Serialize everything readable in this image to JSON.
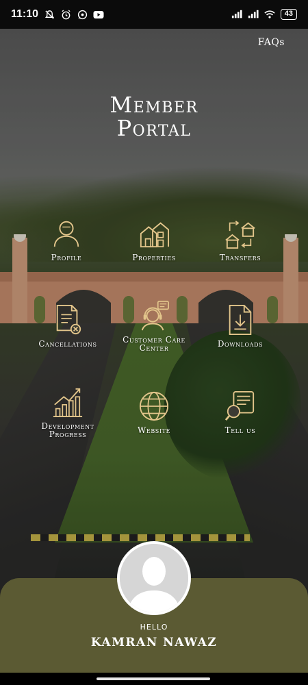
{
  "status_bar": {
    "time": "11:10",
    "battery": "43",
    "icons": [
      "muted-bell-icon",
      "alarm-icon",
      "whatsapp-icon",
      "youtube-icon",
      "signal-icon",
      "signal-icon",
      "wifi-icon",
      "battery-icon"
    ]
  },
  "header": {
    "faqs_label": "FAQs",
    "title_line1": "Member",
    "title_line2": "Portal"
  },
  "menu": {
    "profile": "Profile",
    "properties": "Properties",
    "transfers": "Transfers",
    "cancellations": "Cancellations",
    "customer_care_line1": "Customer Care",
    "customer_care_line2": "Center",
    "downloads": "Downloads",
    "development_line1": "Development",
    "development_line2": "Progress",
    "website": "Website",
    "tell_us": "Tell us"
  },
  "user": {
    "greeting": "HELLO",
    "name": "KAMRAN NAWAZ"
  },
  "colors": {
    "icon_gold": "#e2c58b",
    "panel": "#5b5a33",
    "text": "#ffffff"
  }
}
